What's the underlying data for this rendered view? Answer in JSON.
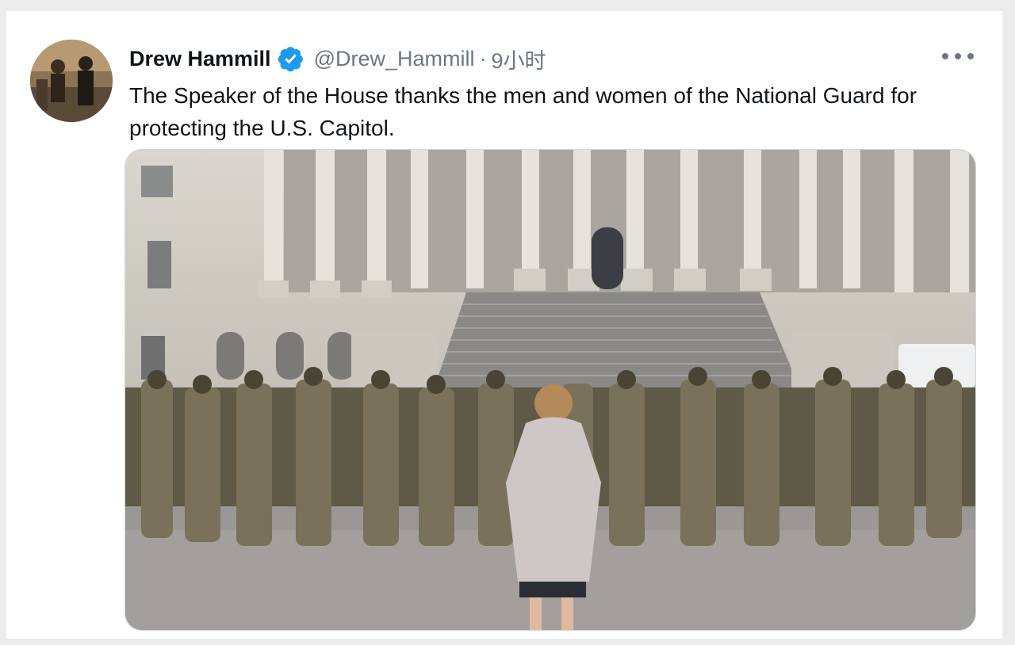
{
  "tweet": {
    "author_name": "Drew Hammill",
    "handle": "@Drew_Hammill",
    "separator": "·",
    "time": "9小时",
    "text": "The Speaker of the House thanks the men and women of the National Guard for protecting the U.S. Capitol.",
    "icons": {
      "avatar": "avatar-photo",
      "verified": "verified-badge-icon",
      "more": "more-options-icon"
    }
  },
  "colors": {
    "verified": "#1d9bf0",
    "secondary_text": "#6b7785",
    "primary_text": "#0f1419"
  }
}
